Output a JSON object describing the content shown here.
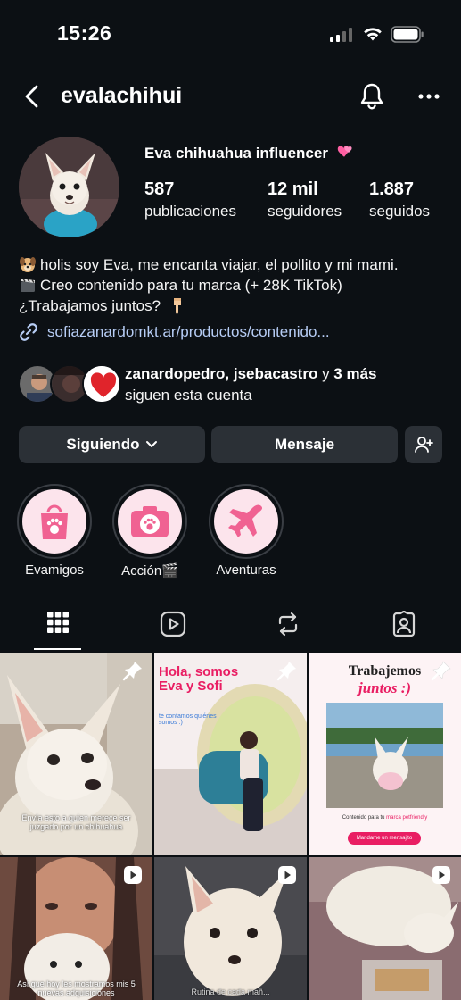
{
  "status_bar": {
    "time": "15:26"
  },
  "header": {
    "username": "evalachihui"
  },
  "profile": {
    "display_name": "Eva chihuahua influencer",
    "stats": [
      {
        "value": "587",
        "label": "publicaciones"
      },
      {
        "value": "12 mil",
        "label": "seguidores"
      },
      {
        "value": "1.887",
        "label": "seguidos"
      }
    ],
    "bio": [
      "holis soy Eva, me encanta viajar, el pollito y mi mami.",
      "Creo contenido para tu marca (+ 28K TikTok)",
      "¿Trabajamos juntos?"
    ],
    "link": "sofiazanardomkt.ar/productos/contenido...",
    "followed_by": {
      "names": "zanardopedro, jsebacastro",
      "connector": " y ",
      "more": "3 más",
      "line2": "siguen esta cuenta"
    }
  },
  "actions": {
    "following_label": "Siguiendo",
    "message_label": "Mensaje"
  },
  "highlights": [
    {
      "label": "Evamigos",
      "icon": "shopping-bag-paw-icon"
    },
    {
      "label": "Acción🎬",
      "icon": "camera-paw-icon"
    },
    {
      "label": "Aventuras",
      "icon": "airplane-icon"
    }
  ],
  "tabs": [
    {
      "name": "grid",
      "icon": "grid-icon",
      "active": true
    },
    {
      "name": "reels",
      "icon": "reels-icon"
    },
    {
      "name": "reposts",
      "icon": "repost-icon"
    },
    {
      "name": "tagged",
      "icon": "tagged-person-icon"
    }
  ],
  "posts": {
    "p1": {
      "caption": "Envía esto a quien merece ser juzgado por un chihuahua"
    },
    "p2": {
      "title": "Hola, somos Eva y Sofi",
      "subtitle": "te contamos quiénes somos :)"
    },
    "p3": {
      "title1": "Trabajemos",
      "title2": "juntos :)",
      "body_prefix": "Contenido para tu ",
      "body_highlight": "marca petfriendly",
      "cta": "Mandame un mensajito"
    },
    "p4": {
      "caption": "Así que hoy les mostramos mis 5 nuevas adquisiciones"
    },
    "p5": {
      "caption": "Rutina de cada mañ..."
    }
  },
  "colors": {
    "background": "#0c1014",
    "button": "#2b3036",
    "link": "#b7cdf5",
    "highlight_pink": "#f06292",
    "highlight_bg": "#fce4ec"
  }
}
